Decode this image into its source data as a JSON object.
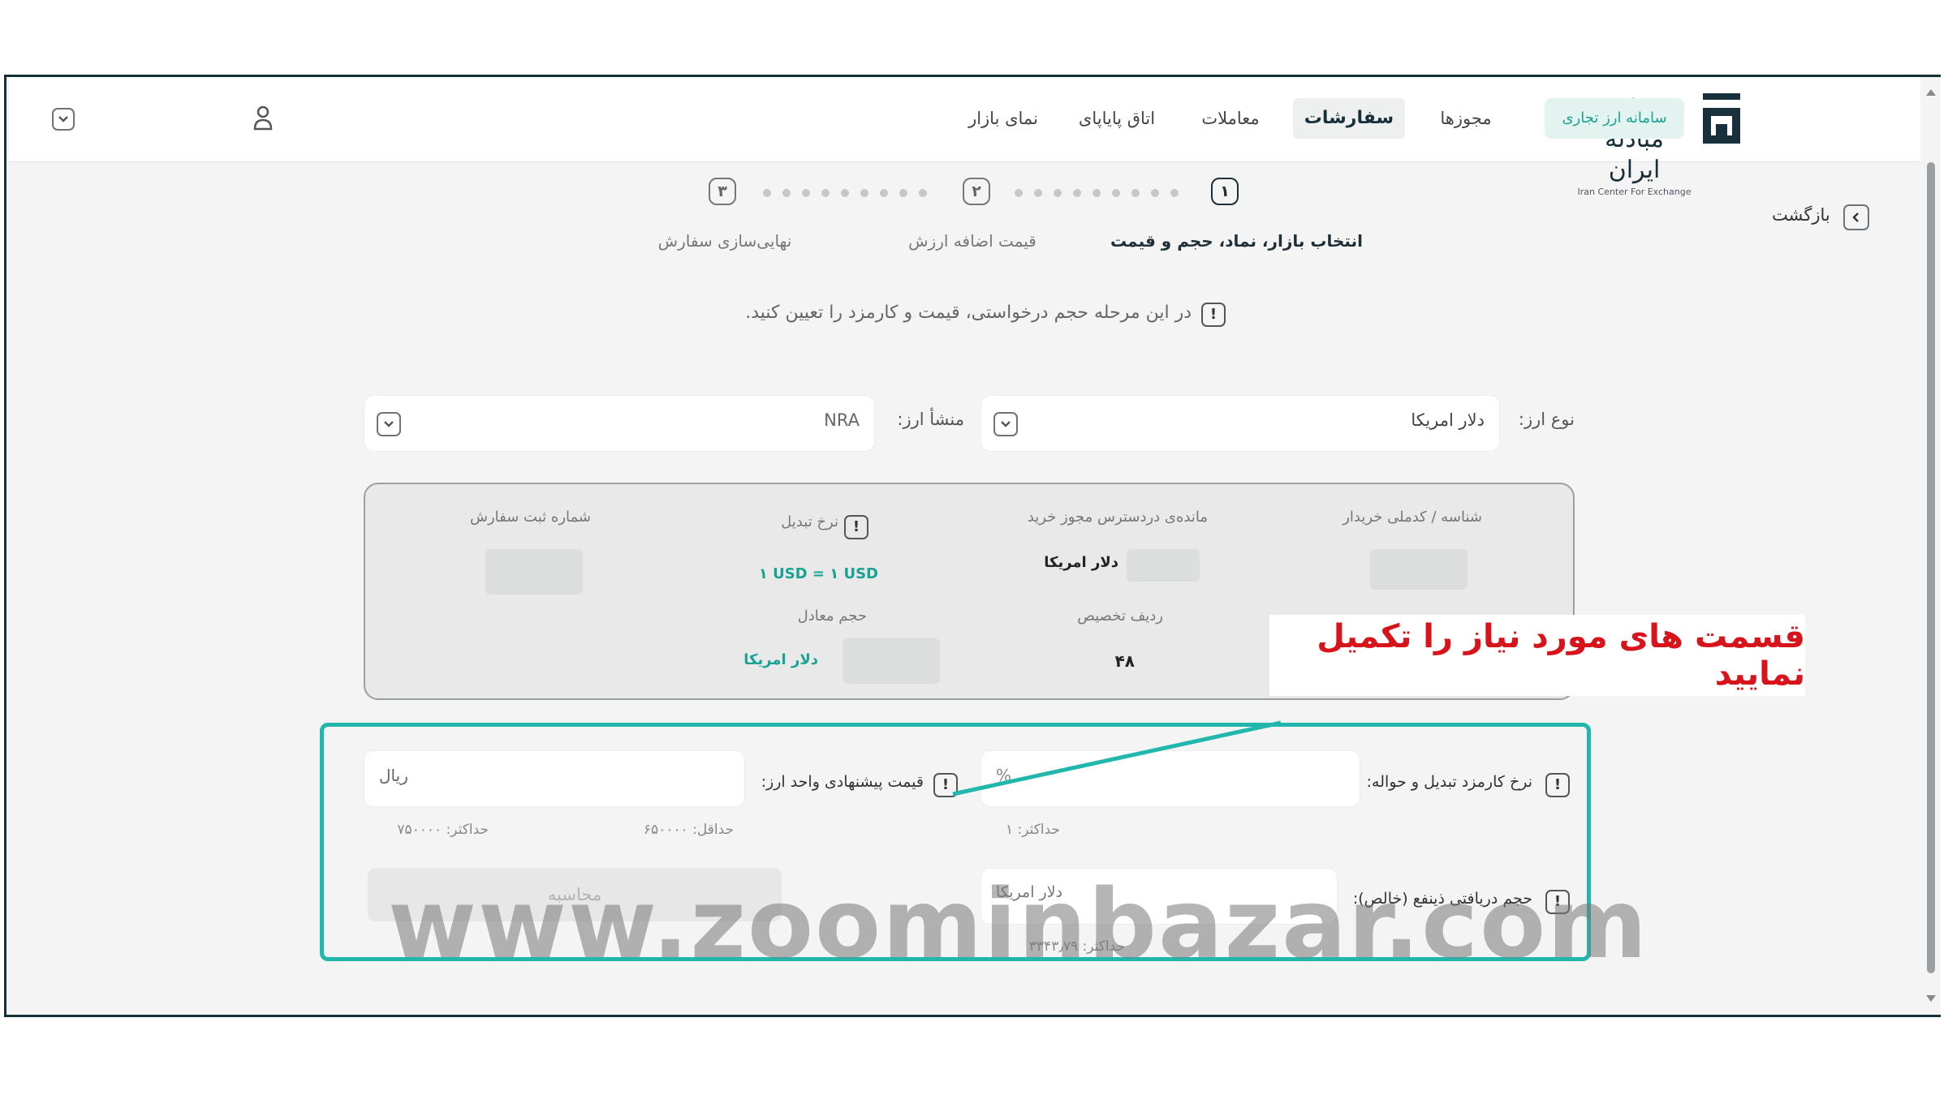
{
  "brand": {
    "name_fa": "مرکز مبادله ایران",
    "name_en": "Iran Center For Exchange"
  },
  "nav": {
    "system_pill": "سامانه ارز تجاری",
    "items": [
      "مجوزها",
      "سفارشات",
      "معاملات",
      "اتاق پایاپای",
      "نمای بازار"
    ],
    "active": "سفارشات"
  },
  "back_label": "بازگشت",
  "steps": [
    {
      "number": "۱",
      "label": "انتخاب بازار، نماد، حجم و قیمت",
      "active": true
    },
    {
      "number": "۲",
      "label": "قیمت اضافه ارزش",
      "active": false
    },
    {
      "number": "۳",
      "label": "نهایی‌سازی سفارش",
      "active": false
    }
  ],
  "info_message": "در این مرحله حجم درخواستی، قیمت و کارمزد را تعیین کنید.",
  "currency_type": {
    "label": "نوع ارز:",
    "value": "دلار امریکا"
  },
  "currency_origin": {
    "label": "منشأ ارز:",
    "value": "NRA"
  },
  "summary": {
    "buyer_id_label": "شناسه / کدملی خریدار",
    "remaining_label": "مانده‌ی دردسترس مجوز خرید",
    "remaining_value": "دلار امریکا",
    "conversion_rate_label": "نرخ تبدیل",
    "conversion_rate_value": "۱ USD = ۱ USD",
    "order_reg_label": "شماره ثبت سفارش",
    "allocation_row_label": "ردیف تخصیص",
    "allocation_row_value": "۴۸",
    "equivalent_volume_label": "حجم معادل",
    "equivalent_volume_value": "دلار امریکا"
  },
  "fee_field": {
    "label": "نرخ کارمزد تبدیل و حواله:",
    "unit": "%",
    "max_hint": "حداکثر: ۱"
  },
  "price_field": {
    "label": "قیمت پیشنهادی واحد ارز:",
    "unit": "ریال",
    "min_hint": "حداقل: ۶۵۰۰۰۰",
    "max_hint": "حداکثر: ۷۵۰۰۰۰"
  },
  "net_field": {
    "label": "حجم دریافتی ذینفع (خالص):",
    "unit": "دلار امریکا",
    "max_hint": "حداکثر: ۳۳۴۳٫۷۹"
  },
  "calculate_button": "محاسبه",
  "callout": "قسمت های مورد نیاز را تکمیل نمایید",
  "watermark": "www.zoominbazar.com",
  "colors": {
    "accent": "#22b7ac",
    "callout_text": "#d7141c",
    "dark": "#17303b"
  }
}
